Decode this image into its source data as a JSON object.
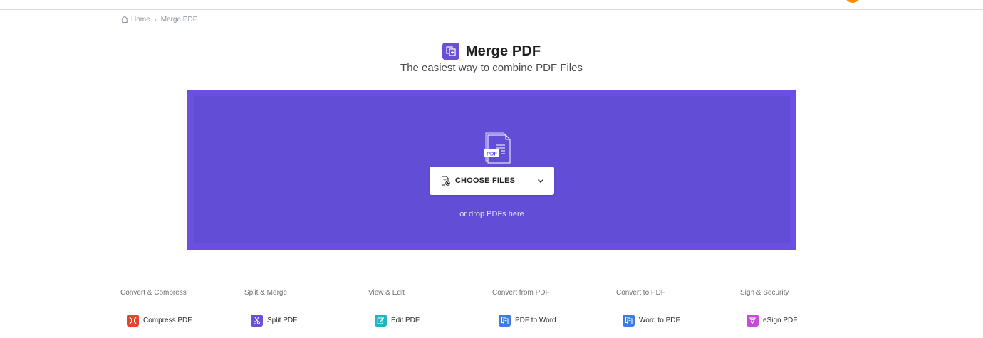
{
  "breadcrumb": {
    "home": "Home",
    "separator": "›",
    "current": "Merge PDF"
  },
  "header": {
    "title": "Merge PDF",
    "subtitle": "The easiest way to combine PDF Files",
    "icon": "merge-pdf-icon"
  },
  "dropzone": {
    "choose_label": "CHOOSE FILES",
    "hint": "or drop PDFs here",
    "doc_badge": "PDF",
    "colors": {
      "outer": "#6b4fe0",
      "inner": "#614dd6"
    }
  },
  "categories": [
    {
      "title": "Convert & Compress",
      "tool": "Compress PDF",
      "icon": "compress-icon",
      "color": "#e8412c"
    },
    {
      "title": "Split & Merge",
      "tool": "Split PDF",
      "icon": "split-icon",
      "color": "#6a4fd8"
    },
    {
      "title": "View & Edit",
      "tool": "Edit PDF",
      "icon": "edit-icon",
      "color": "#22b3c4"
    },
    {
      "title": "Convert from PDF",
      "tool": "PDF to Word",
      "icon": "word-doc-icon",
      "color": "#3d7be8"
    },
    {
      "title": "Convert to PDF",
      "tool": "Word to PDF",
      "icon": "word-doc-icon",
      "color": "#3d7be8"
    },
    {
      "title": "Sign & Security",
      "tool": "eSign PDF",
      "icon": "esign-icon",
      "color": "#c44fd6"
    }
  ]
}
